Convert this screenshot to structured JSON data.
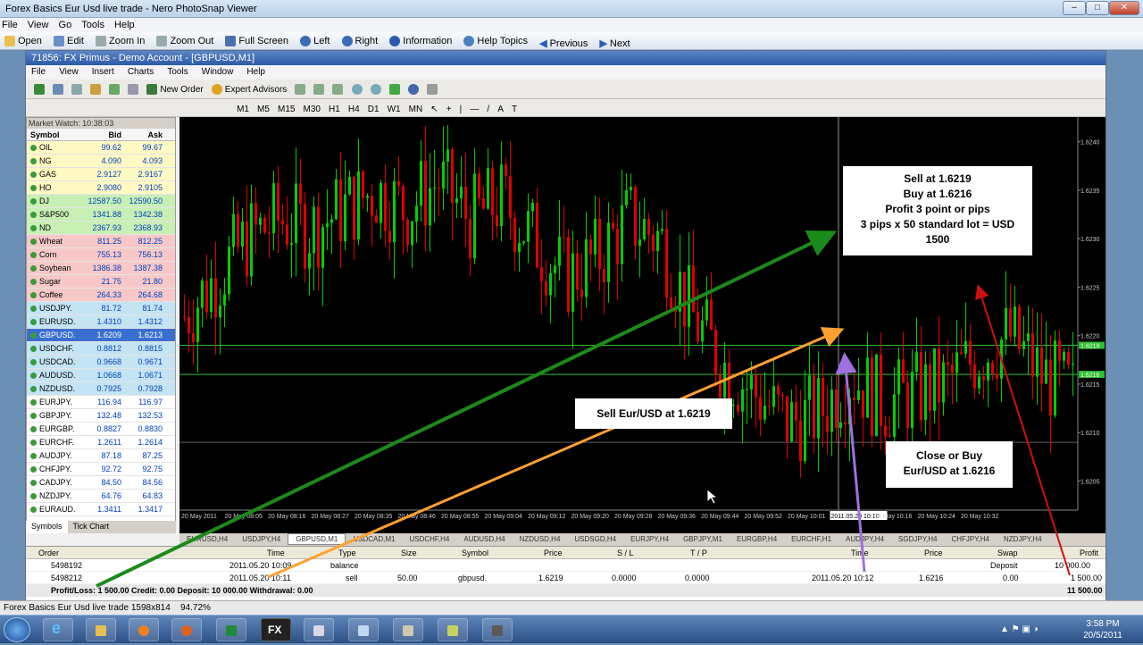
{
  "viewer": {
    "title": "Forex Basics Eur Usd live trade - Nero PhotoSnap Viewer",
    "menu": [
      "File",
      "View",
      "Go",
      "Tools",
      "Help"
    ],
    "toolbar": [
      "Open",
      "Edit",
      "Zoom In",
      "Zoom Out",
      "Full Screen",
      "Left",
      "Right",
      "Information",
      "Help Topics",
      "Previous",
      "Next"
    ],
    "status_left": "Forex Basics Eur Usd live trade 1598x814",
    "status_zoom": "94.72%"
  },
  "mt4": {
    "title": "71856: FX Primus - Demo Account - [GBPUSD,M1]",
    "menu": [
      "File",
      "View",
      "Insert",
      "Charts",
      "Tools",
      "Window",
      "Help"
    ],
    "toolbar": {
      "new_order": "New Order",
      "expert_advisors": "Expert Advisors"
    },
    "timeframes": [
      "M1",
      "M5",
      "M15",
      "M30",
      "H1",
      "H4",
      "D1",
      "W1",
      "MN"
    ],
    "market_watch": {
      "header": "Market Watch: 10:38:03",
      "cols": [
        "Symbol",
        "Bid",
        "Ask"
      ],
      "rows": [
        {
          "s": "OIL",
          "b": "99.62",
          "a": "99.67",
          "bg": "#fff9c4"
        },
        {
          "s": "NG",
          "b": "4.090",
          "a": "4.093",
          "bg": "#fff9c4"
        },
        {
          "s": "GAS",
          "b": "2.9127",
          "a": "2.9167",
          "bg": "#fff9c4"
        },
        {
          "s": "HO",
          "b": "2.9080",
          "a": "2.9105",
          "bg": "#fff9c4"
        },
        {
          "s": "DJ",
          "b": "12587.50",
          "a": "12590.50",
          "bg": "#c8f0b4"
        },
        {
          "s": "S&P500",
          "b": "1341.88",
          "a": "1342.38",
          "bg": "#c8f0b4"
        },
        {
          "s": "ND",
          "b": "2367.93",
          "a": "2368.93",
          "bg": "#c8f0b4"
        },
        {
          "s": "Wheat",
          "b": "811.25",
          "a": "812.25",
          "bg": "#f8c8c8"
        },
        {
          "s": "Corn",
          "b": "755.13",
          "a": "756.13",
          "bg": "#f8c8c8"
        },
        {
          "s": "Soybean",
          "b": "1386.38",
          "a": "1387.38",
          "bg": "#f8c8c8"
        },
        {
          "s": "Sugar",
          "b": "21.75",
          "a": "21.80",
          "bg": "#f8c8c8"
        },
        {
          "s": "Coffee",
          "b": "264.33",
          "a": "264.68",
          "bg": "#f8c8c8"
        },
        {
          "s": "USDJPY.",
          "b": "81.72",
          "a": "81.74",
          "bg": "#c4e4f4"
        },
        {
          "s": "EURUSD.",
          "b": "1.4310",
          "a": "1.4312",
          "bg": "#c4e4f4"
        },
        {
          "s": "GBPUSD.",
          "b": "1.6209",
          "a": "1.6213",
          "bg": "#3a6fd0"
        },
        {
          "s": "USDCHF.",
          "b": "0.8812",
          "a": "0.8815",
          "bg": "#c4e4f4"
        },
        {
          "s": "USDCAD.",
          "b": "0.9668",
          "a": "0.9671",
          "bg": "#c4e4f4"
        },
        {
          "s": "AUDUSD.",
          "b": "1.0668",
          "a": "1.0671",
          "bg": "#c4e4f4"
        },
        {
          "s": "NZDUSD.",
          "b": "0.7925",
          "a": "0.7928",
          "bg": "#c4e4f4"
        },
        {
          "s": "EURJPY.",
          "b": "116.94",
          "a": "116.97",
          "bg": "#ffffff"
        },
        {
          "s": "GBPJPY.",
          "b": "132.48",
          "a": "132.53",
          "bg": "#ffffff"
        },
        {
          "s": "EURGBP.",
          "b": "0.8827",
          "a": "0.8830",
          "bg": "#ffffff"
        },
        {
          "s": "EURCHF.",
          "b": "1.2611",
          "a": "1.2614",
          "bg": "#ffffff"
        },
        {
          "s": "AUDJPY.",
          "b": "87.18",
          "a": "87.25",
          "bg": "#ffffff"
        },
        {
          "s": "CHFJPY.",
          "b": "92.72",
          "a": "92.75",
          "bg": "#ffffff"
        },
        {
          "s": "CADJPY.",
          "b": "84.50",
          "a": "84.56",
          "bg": "#ffffff"
        },
        {
          "s": "NZDJPY.",
          "b": "64.76",
          "a": "64.83",
          "bg": "#ffffff"
        },
        {
          "s": "EURAUD.",
          "b": "1.3411",
          "a": "1.3417",
          "bg": "#ffffff"
        }
      ],
      "tabs": [
        "Symbols",
        "Tick Chart"
      ]
    },
    "chart": {
      "price_labels": [
        "1.6240",
        "1.6235",
        "1.6230",
        "1.6225",
        "1.6220",
        "1.6215",
        "1.6210",
        "1.6205"
      ],
      "marker_sell": "1.6219",
      "marker_buy": "1.6216",
      "time_labels": [
        "20 May 2011",
        "20 May 08:05",
        "20 May 08:16",
        "20 May 08:27",
        "20 May 08:35",
        "20 May 08:46",
        "20 May 08:55",
        "20 May 09:04",
        "20 May 09:12",
        "20 May 09:20",
        "20 May 09:28",
        "20 May 09:36",
        "20 May 09:44",
        "20 May 09:52",
        "20 May 10:01",
        "2011.05.20 10:10",
        "20 May 10:16",
        "20 May 10:24",
        "20 May 10:32"
      ],
      "tabs": [
        "EURUSD,H4",
        "USDJPY,H4",
        "GBPUSD,M1",
        "USDCAD,M1",
        "USDCHF,H4",
        "AUDUSD,H4",
        "NZDUSD,H4",
        "USDSGD,H4",
        "EURJPY,H4",
        "GBPJPY,M1",
        "EURGBP,H4",
        "EURCHF,H1",
        "AUDJPY,H4",
        "SGDJPY,H4",
        "CHFJPY,H4",
        "NZDJPY,H4"
      ]
    },
    "annotations": {
      "box1": [
        "Sell at 1.6219",
        "Buy  at 1.6216",
        "Profit   3 point or pips",
        "3 pips x 50 standard lot = USD",
        "1500"
      ],
      "box2": "Sell Eur/USD at 1.6219",
      "box3": [
        "Close or Buy",
        "Eur/USD at 1.6216"
      ]
    },
    "terminal": {
      "cols": [
        "Order",
        "Time",
        "Type",
        "Size",
        "Symbol",
        "Price",
        "S / L",
        "T / P",
        "Time",
        "Price",
        "Swap",
        "Profit"
      ],
      "row1": {
        "order": "5498192",
        "time": "2011.05.20 10:09",
        "type": "balance",
        "deposit": "Deposit",
        "profit": "10 000.00"
      },
      "row2": {
        "order": "5498212",
        "time": "2011.05.20 10:11",
        "type": "sell",
        "size": "50.00",
        "symbol": "gbpusd.",
        "price": "1.6219",
        "sl": "0.0000",
        "tp": "0.0000",
        "close_time": "2011.05.20 10:12",
        "close_price": "1.6216",
        "swap": "0.00",
        "profit": "1 500.00"
      },
      "summary": "Profit/Loss: 1 500.00  Credit: 0.00  Deposit: 10 000.00  Withdrawal: 0.00",
      "total": "11 500.00"
    }
  },
  "taskbar": {
    "time": "3:58 PM",
    "date": "20/5/2011"
  },
  "colors": {
    "bull": "#00d000",
    "bear": "#e00000",
    "green_arrow": "#1a8a1a",
    "orange_arrow": "#ffa030",
    "purple_arrow": "#a070e0",
    "red_arrow": "#d01010"
  }
}
